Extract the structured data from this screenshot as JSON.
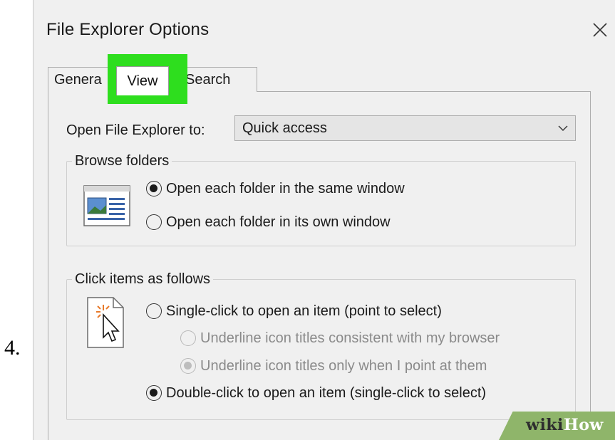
{
  "step_number": "4.",
  "window": {
    "title": "File Explorer Options",
    "close_icon": "close-icon"
  },
  "tabs": {
    "general": "Genera",
    "view": "View",
    "search": "Search"
  },
  "open_explorer": {
    "label": "Open File Explorer to:",
    "value": "Quick access",
    "chevron_icon": "chevron-down-icon"
  },
  "browse_folders": {
    "legend": "Browse folders",
    "options": [
      {
        "label": "Open each folder in the same window",
        "checked": true
      },
      {
        "label": "Open each folder in its own window",
        "checked": false
      }
    ]
  },
  "click_items": {
    "legend": "Click items as follows",
    "options": [
      {
        "label": "Single-click to open an item (point to select)",
        "checked": false
      },
      {
        "label": "Underline icon titles consistent with my browser",
        "checked": false,
        "disabled": true
      },
      {
        "label": "Underline icon titles only when I point at them",
        "checked": true,
        "disabled": true
      },
      {
        "label": "Double-click to open an item (single-click to select)",
        "checked": true
      }
    ]
  },
  "watermark": {
    "part1": "wiki",
    "part2": "How"
  },
  "colors": {
    "highlight": "#2ede1e",
    "window_bg": "#f0f0f0",
    "watermark_bg": "#8fb56a"
  }
}
